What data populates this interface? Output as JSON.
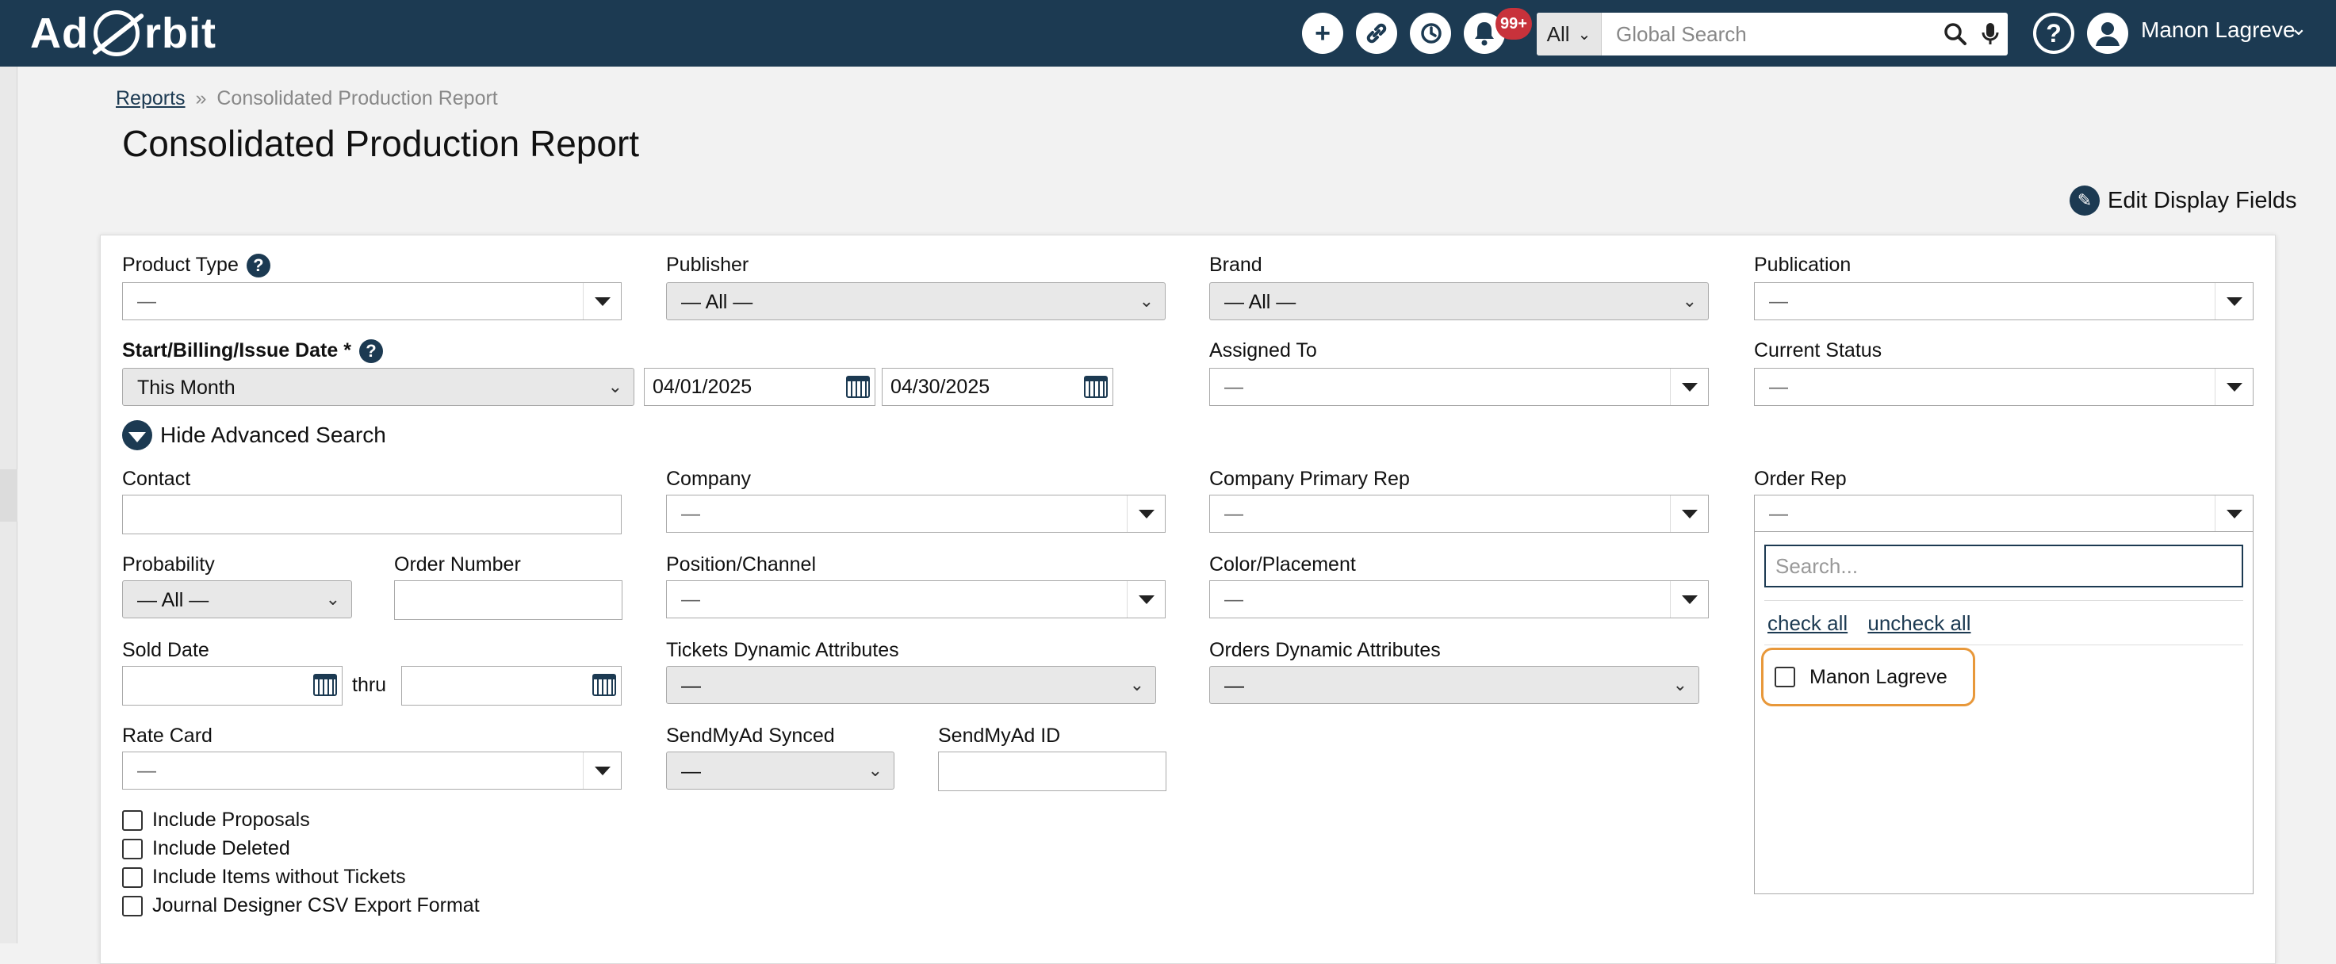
{
  "app": {
    "logo_left": "Ad",
    "logo_right": "rbit",
    "notification_badge": "99+",
    "search_scope": "All",
    "search_placeholder": "Global Search",
    "user_name": "Manon Lagreve"
  },
  "breadcrumb": {
    "parent": "Reports",
    "separator": "»",
    "current": "Consolidated Production Report"
  },
  "page_title": "Consolidated Production Report",
  "edit_display_fields": "Edit Display Fields",
  "filters": {
    "product_type": {
      "label": "Product Type",
      "value": "—"
    },
    "publisher": {
      "label": "Publisher",
      "value": "— All —"
    },
    "brand": {
      "label": "Brand",
      "value": "— All —"
    },
    "publication": {
      "label": "Publication",
      "value": "—"
    },
    "date": {
      "label": "Start/Billing/Issue Date *",
      "range": "This Month",
      "start": "04/01/2025",
      "end": "04/30/2025"
    },
    "assigned_to": {
      "label": "Assigned To",
      "value": "—"
    },
    "current_status": {
      "label": "Current Status",
      "value": "—"
    },
    "hide_advanced": "Hide Advanced Search",
    "contact": {
      "label": "Contact",
      "value": ""
    },
    "company": {
      "label": "Company",
      "value": "—"
    },
    "company_primary_rep": {
      "label": "Company Primary Rep",
      "value": "—"
    },
    "order_rep": {
      "label": "Order Rep",
      "value": "—"
    },
    "probability": {
      "label": "Probability",
      "value": "— All —"
    },
    "order_number": {
      "label": "Order Number",
      "value": ""
    },
    "position_channel": {
      "label": "Position/Channel",
      "value": "—"
    },
    "color_placement": {
      "label": "Color/Placement",
      "value": "—"
    },
    "sold_date": {
      "label": "Sold Date",
      "thru": "thru"
    },
    "tickets_dyn": {
      "label": "Tickets Dynamic Attributes",
      "value": "—"
    },
    "orders_dyn": {
      "label": "Orders Dynamic Attributes",
      "value": "—"
    },
    "rate_card": {
      "label": "Rate Card",
      "value": "—"
    },
    "sendmyad_synced": {
      "label": "SendMyAd Synced",
      "value": "—"
    },
    "sendmyad_id": {
      "label": "SendMyAd ID",
      "value": ""
    }
  },
  "checkboxes": [
    "Include Proposals",
    "Include Deleted",
    "Include Items without Tickets",
    "Journal Designer CSV Export Format"
  ],
  "order_rep_dropdown": {
    "search_placeholder": "Search...",
    "check_all": "check all",
    "uncheck_all": "uncheck all",
    "options": [
      "Manon Lagreve"
    ]
  }
}
